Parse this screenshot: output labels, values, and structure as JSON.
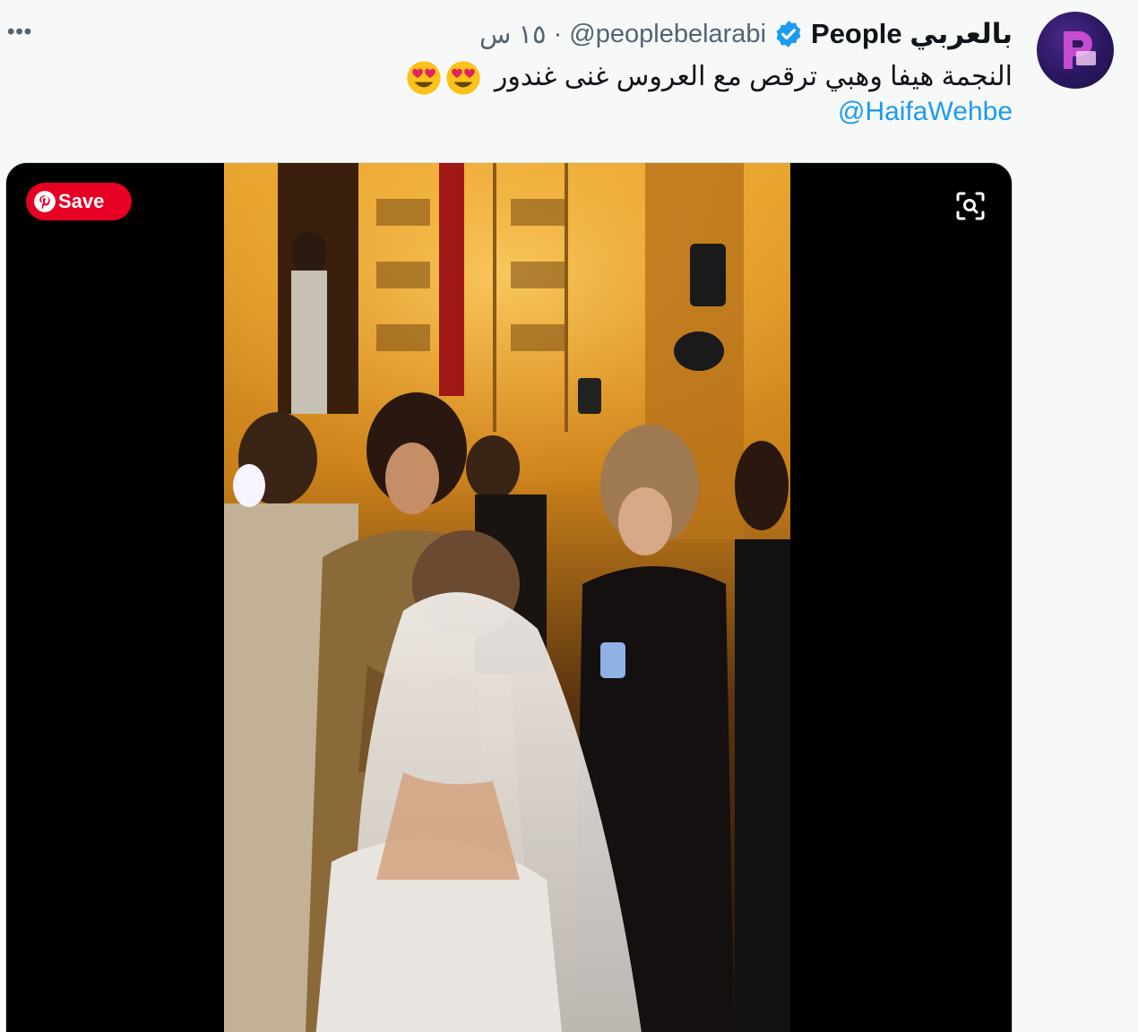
{
  "tweet": {
    "display_name": "People بالعربي",
    "handle": "@peoplebelarabi",
    "separator": "·",
    "time": "١٥ س",
    "text": "النجمة هيفا وهبي ترقص مع العروس غنى غندور",
    "mention": "@HaifaWehbe",
    "emoji": [
      "smiling-face-with-heart-eyes",
      "smiling-face-with-heart-eyes"
    ],
    "more_label": "•••"
  },
  "media": {
    "pinterest_save_label": "Save",
    "brand_colors": {
      "pinterest": "#e60023",
      "link": "#1d9bf0",
      "verified": "#1d9bf0"
    }
  }
}
